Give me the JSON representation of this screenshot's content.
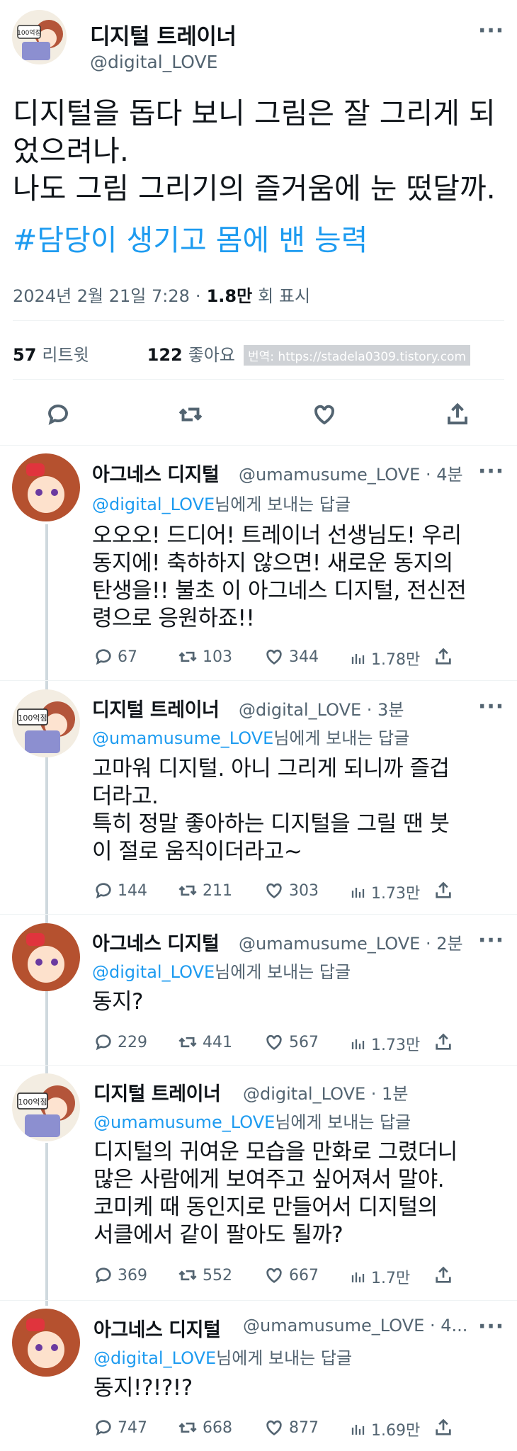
{
  "main_tweet": {
    "author_name": "디지털 트레이너",
    "author_handle": "@digital_LOVE",
    "text_line1": "디지털을 돕다 보니 그림은 잘 그리게 되",
    "text_line2": "었으려나.",
    "text_line3": "나도 그림 그리기의 즐거움에 눈 떴달까.",
    "hashtag": "#담당이 생기고 몸에 밴 능력",
    "timestamp": "2024년 2월 21일  7:28",
    "views_count": "1.8만",
    "views_label": "회 표시",
    "retweets_count": "57",
    "retweets_label": "리트윗",
    "likes_count": "122",
    "likes_label": "좋아요",
    "watermark": "번역: https://stadela0309.tistory.com"
  },
  "replies": [
    {
      "name": "아그네스 디지털",
      "handle": "@umamusume_LOVE",
      "time": "· 4분",
      "reply_to": "@digital_LOVE",
      "reply_suffix": "님에게 보내는 답글",
      "lines": [
        "오오오! 드디어! 트레이너 선생님도! 우리",
        "동지에! 축하하지 않으면! 새로운 동지의",
        "탄생을!! 불초 이 아그네스 디지털, 전신전",
        "령으로 응원하죠!!"
      ],
      "replies": "67",
      "retweets": "103",
      "likes": "344",
      "views": "1.78만"
    },
    {
      "name": "디지털 트레이너",
      "handle": "@digital_LOVE",
      "time": "· 3분",
      "reply_to": "@umamusume_LOVE",
      "reply_suffix": "님에게 보내는 답글",
      "lines": [
        "고마워 디지털. 아니 그리게 되니까 즐겁",
        "더라고.",
        "특히 정말 좋아하는 디지털을 그릴 땐 붓",
        "이 절로 움직이더라고~"
      ],
      "replies": "144",
      "retweets": "211",
      "likes": "303",
      "views": "1.73만"
    },
    {
      "name": "아그네스 디지털",
      "handle": "@umamusume_LOVE",
      "time": "· 2분",
      "reply_to": "@digital_LOVE",
      "reply_suffix": "님에게 보내는 답글",
      "lines": [
        "동지?"
      ],
      "replies": "229",
      "retweets": "441",
      "likes": "567",
      "views": "1.73만"
    },
    {
      "name": "디지털 트레이너",
      "handle": "@digital_LOVE",
      "time": "· 1분",
      "reply_to": "@umamusume_LOVE",
      "reply_suffix": "님에게 보내는 답글",
      "lines": [
        "디지털의 귀여운 모습을 만화로 그렸더니",
        "많은 사람에게 보여주고 싶어져서 말야.",
        "코미케 때 동인지로 만들어서 디지털의",
        "서클에서 같이 팔아도 될까?"
      ],
      "replies": "369",
      "retweets": "552",
      "likes": "667",
      "views": "1.7만"
    },
    {
      "name": "아그네스 디지털",
      "handle": "@umamusume_LOVE",
      "time": "· 4...",
      "reply_to": "@digital_LOVE",
      "reply_suffix": "님에게 보내는 답글",
      "lines": [
        "동지!?!?!?"
      ],
      "replies": "747",
      "retweets": "668",
      "likes": "877",
      "views": "1.69만"
    }
  ],
  "avatar_badge": "100억점",
  "colors": {
    "link": "#1d9bf0",
    "gray": "#536471",
    "divider": "#eff3f4",
    "thread": "#cfd9de"
  },
  "icons": [
    "more-icon",
    "reply-icon",
    "retweet-icon",
    "like-icon",
    "share-icon",
    "views-icon"
  ]
}
